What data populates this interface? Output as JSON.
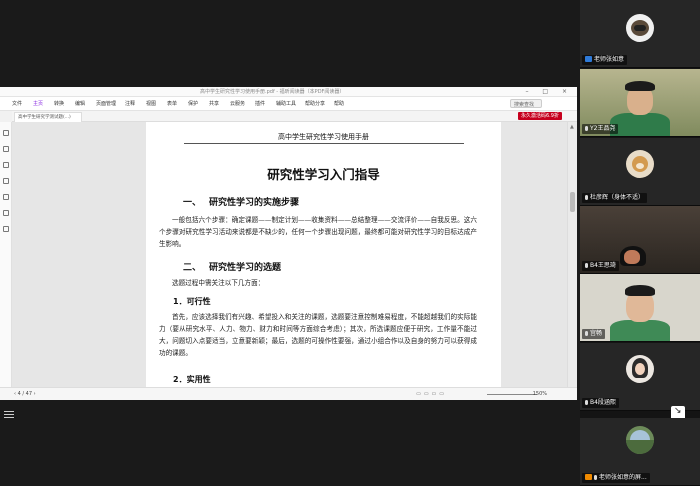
{
  "viewer": {
    "window_title": "高中学生研究性学习使用手册.pdf - 福昕阅读器（本PDF阅读器）",
    "menu": [
      "文件",
      "主页",
      "转换",
      "编辑",
      "页面管理",
      "注释",
      "视图",
      "表单",
      "保护",
      "共享",
      "云服务",
      "插件",
      "辅助工具",
      "帮助分享",
      "帮助"
    ],
    "active_menu_index": 1,
    "search_placeholder": "搜索查找",
    "doc_tab_title": "高中学生研究学测试题(...)",
    "promo_badge": "永久激活码6.9折",
    "page_indicator": "4 / 47",
    "zoom_level": "150%"
  },
  "page": {
    "running_header": "高中学生研究性学习使用手册",
    "title": "研究性学习入门指导",
    "section1": {
      "number": "一、",
      "heading": "研究性学习的实施步骤",
      "para": "一般包括六个步骤：确定课题——制定计划——收集资料——总结整理——交流评价——自我反思。这六个步骤对研究性学习活动来说都是不缺少的，任何一个步骤出现问题，最终都可能对研究性学习的目标达成产生影响。"
    },
    "section2": {
      "number": "二、",
      "heading": "研究性学习的选题",
      "intro": "选题过程中需关注以下几方面：",
      "sub1_heading": "1．可行性",
      "sub1_para": "首先，应该选择我们有兴趣、希望投入和关注的课题，选题要注意控制难易程度，不能超越我们的实际能力（要从研究水平、人力、物力、财力和时间等方面综合考虑）；其次，所选课题应便于研究，工作量不能过大，问题切入点要适当，立意要新颖；最后，选题的可操作性要强，通过小组合作以及自身的努力可以获得成功的课题。",
      "sub2_heading": "2．实用性"
    }
  },
  "participants": [
    {
      "name": "老师张如意",
      "host": true,
      "kind": "avatar-teacher"
    },
    {
      "name": "Y2王品尧",
      "host": false,
      "kind": "camera-boy-green"
    },
    {
      "name": "杜彦辉（身体不适）",
      "host": false,
      "kind": "avatar-dog"
    },
    {
      "name": "B4王思琦",
      "host": false,
      "kind": "camera-dim"
    },
    {
      "name": "宫畅",
      "host": false,
      "kind": "camera-boy-green2"
    },
    {
      "name": "B4段涵熙",
      "host": false,
      "kind": "avatar-girl"
    },
    {
      "name": "老师张如意的屏...",
      "host": true,
      "kind": "avatar-landscape"
    }
  ],
  "colors": {
    "background": "#1a1a1a",
    "accent": "#8a2be2",
    "promo": "#c6001e",
    "host_badge": "#2f7bd9"
  }
}
